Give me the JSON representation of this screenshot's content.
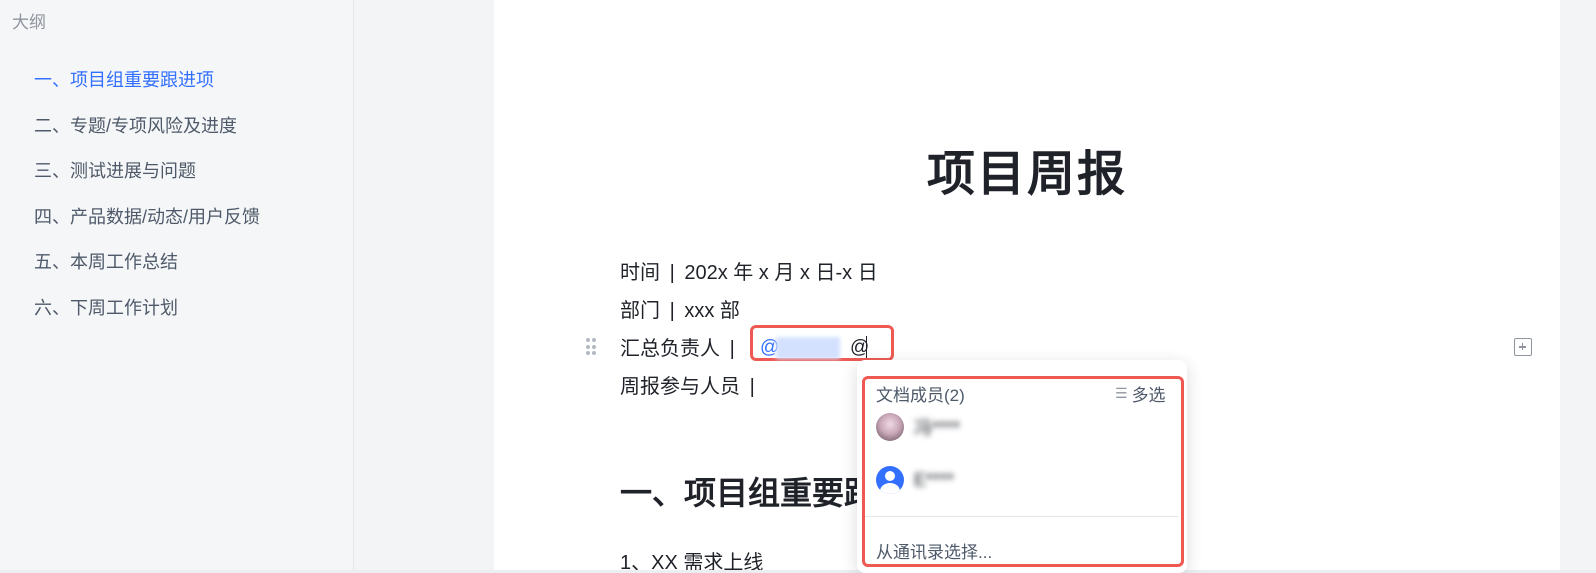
{
  "outline": {
    "title": "大纲",
    "items": [
      {
        "label": "一、项目组重要跟进项",
        "active": true
      },
      {
        "label": "二、专题/专项风险及进度",
        "active": false
      },
      {
        "label": "三、测试进展与问题",
        "active": false
      },
      {
        "label": "四、产品数据/动态/用户反馈",
        "active": false
      },
      {
        "label": "五、本周工作总结",
        "active": false
      },
      {
        "label": "六、下周工作计划",
        "active": false
      }
    ]
  },
  "doc": {
    "title": "项目周报",
    "time_label": "时间",
    "time_value": "202x 年 x 月 x 日-x 日",
    "dept_label": "部门",
    "dept_value": "xxx 部",
    "owner_label": "汇总负责人",
    "participants_label": "周报参与人员",
    "separator": "|",
    "section1": "一、项目组重要跟进项",
    "sub1": "1、XX 需求上线"
  },
  "mention": {
    "at_symbol": "@",
    "typed": "@"
  },
  "popup": {
    "header": "文档成员(2)",
    "multi_select": "多选",
    "members": [
      {
        "name": "冯****"
      },
      {
        "name": "E****"
      }
    ],
    "contacts": "从通讯录选择..."
  },
  "colors": {
    "accent": "#3370ff",
    "highlight": "#ee5a52"
  },
  "icons": [
    "drag-handle-icon",
    "comment-add-icon",
    "multi-select-icon",
    "user-avatar-icon"
  ]
}
